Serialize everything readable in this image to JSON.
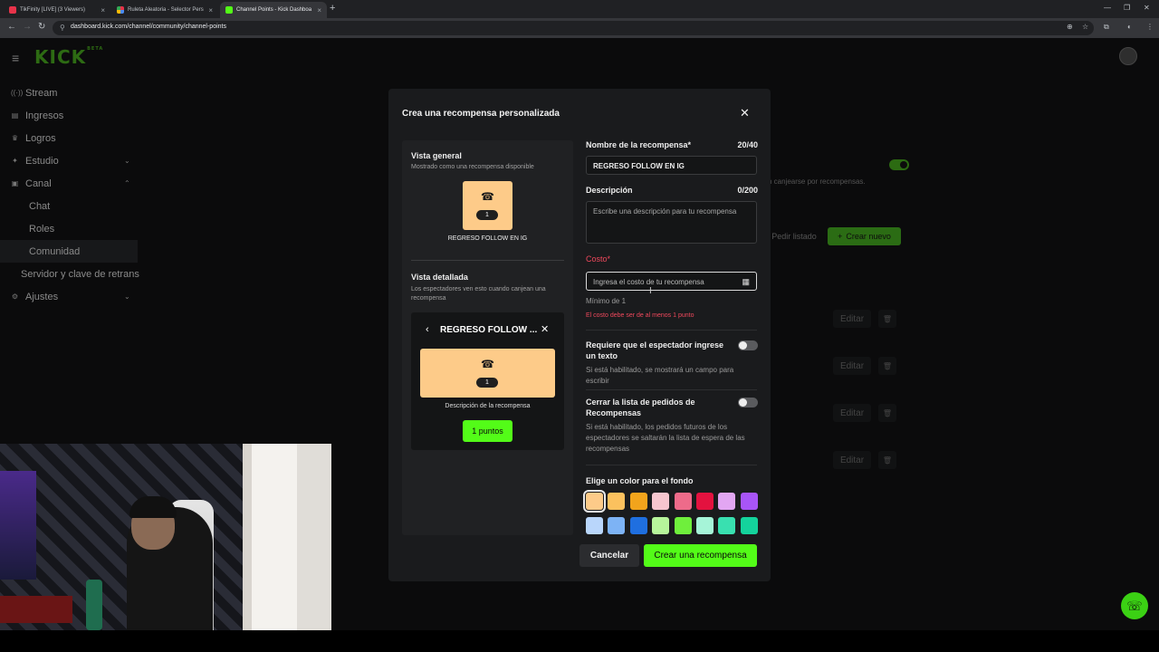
{
  "browser": {
    "tabs": [
      {
        "title": "TikFinity [LIVE] (3 Viewers)",
        "color": "#e8334a",
        "active": false
      },
      {
        "title": "Ruleta Aleatoria - Selector Pers",
        "color": "#4a8af4",
        "active": false
      },
      {
        "title": "Channel Points - Kick Dashboa",
        "color": "#53fc18",
        "active": true
      }
    ],
    "url": "dashboard.kick.com/channel/community/channel-points"
  },
  "app": {
    "logo": "KICK",
    "logo_badge": "BETA"
  },
  "sidebar": {
    "items": [
      {
        "label": "Stream",
        "icon": "broadcast-icon",
        "glyph": "((·))",
        "sub": false,
        "chevron": ""
      },
      {
        "label": "Ingresos",
        "icon": "wallet-icon",
        "glyph": "▤",
        "sub": false,
        "chevron": ""
      },
      {
        "label": "Logros",
        "icon": "trophy-icon",
        "glyph": "♛",
        "sub": false,
        "chevron": ""
      },
      {
        "label": "Estudio",
        "icon": "studio-icon",
        "glyph": "✦",
        "sub": false,
        "chevron": "⌄"
      },
      {
        "label": "Canal",
        "icon": "channel-icon",
        "glyph": "▣",
        "sub": false,
        "chevron": "⌃"
      },
      {
        "label": "Chat",
        "icon": "",
        "glyph": "",
        "sub": true,
        "chevron": ""
      },
      {
        "label": "Roles",
        "icon": "",
        "glyph": "",
        "sub": true,
        "chevron": ""
      },
      {
        "label": "Comunidad",
        "icon": "",
        "glyph": "",
        "sub": true,
        "chevron": "",
        "selected": true
      },
      {
        "label": "Servidor y clave de retrans",
        "icon": "",
        "glyph": "",
        "sub": true,
        "chevron": ""
      },
      {
        "label": "Ajustes",
        "icon": "gear-icon",
        "glyph": "⚙",
        "sub": false,
        "chevron": "⌄"
      }
    ]
  },
  "background": {
    "description_fragment": "n canjearse por recompensas.",
    "request_list_label": "Pedir listado",
    "create_new_label": "Crear nuevo",
    "edit_label": "Editar"
  },
  "modal": {
    "title": "Crea una recompensa personalizada",
    "overview": {
      "heading": "Vista general",
      "subheading": "Mostrado como una recompensa disponible",
      "cost_badge": "1",
      "reward_name": "REGRESO FOLLOW EN IG"
    },
    "detailed": {
      "heading": "Vista detallada",
      "subheading": "Los espectadores ven esto cuando canjean una recompensa",
      "title": "REGRESO FOLLOW ...",
      "cost_badge": "1",
      "description": "Descripción de la recompensa",
      "points_button": "1 puntos"
    },
    "form": {
      "name_label": "Nombre de la recompensa*",
      "name_count": "20/40",
      "name_value": "REGRESO FOLLOW EN IG",
      "description_label": "Descripción",
      "description_count": "0/200",
      "description_placeholder": "Escribe una descripción para tu recompensa",
      "cost_label": "Costo*",
      "cost_placeholder": "Ingresa el costo de tu recompensa",
      "cost_hint": "Mínimo de 1",
      "cost_error": "El costo debe ser de al menos 1 punto",
      "require_text_label": "Requiere que el espectador ingrese un texto",
      "require_text_hint": "Si está habilitado, se mostrará un campo para escribir",
      "require_text_enabled": false,
      "close_queue_label": "Cerrar la lista de pedidos de Recompensas",
      "close_queue_hint": "Si está habilitado, los pedidos futuros de los espectadores se saltarán la lista de espera de las recompensas",
      "close_queue_enabled": false,
      "color_label": "Elige un color para el fondo",
      "colors": [
        "#fdcb89",
        "#fbc15e",
        "#f2a41c",
        "#f7c6cf",
        "#ee6b8a",
        "#e3123f",
        "#e2a6f2",
        "#a855f7",
        "#b9d6fb",
        "#7db3f5",
        "#1f6fe0",
        "#b7f59b",
        "#6fef3c",
        "#a6f4d8",
        "#39e0b0",
        "#14d39c"
      ],
      "selected_color": "#fdcb89"
    },
    "cancel_label": "Cancelar",
    "create_label": "Crear una recompensa"
  }
}
